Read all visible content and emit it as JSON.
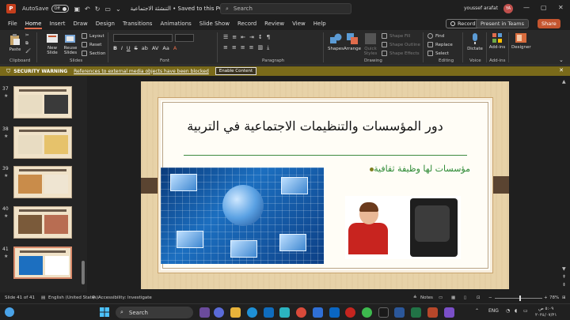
{
  "titlebar": {
    "autosave_label": "AutoSave",
    "autosave_state": "Off",
    "doc_title": "التنشئة الاجتماعية • Saved to this PC ⌄",
    "search_placeholder": "Search",
    "user_name": "youssef arafat",
    "user_initials": "YA"
  },
  "tabs": [
    "File",
    "Home",
    "Insert",
    "Draw",
    "Design",
    "Transitions",
    "Animations",
    "Slide Show",
    "Record",
    "Review",
    "View",
    "Help"
  ],
  "ribbon_actions": {
    "record": "Record",
    "teams": "Present in Teams",
    "share": "Share"
  },
  "ribbon": {
    "paste": "Paste",
    "new_slide": "New Slide",
    "reuse_slides": "Reuse Slides",
    "layout": "Layout",
    "reset": "Reset",
    "section": "Section",
    "shapes": "Shapes",
    "arrange": "Arrange",
    "quick_styles": "Quick Styles",
    "shape_fill": "Shape Fill",
    "shape_outline": "Shape Outline",
    "shape_effects": "Shape Effects",
    "find": "Find",
    "replace": "Replace",
    "select": "Select",
    "dictate": "Dictate",
    "addins": "Add-ins",
    "designer": "Designer",
    "groups": {
      "clipboard": "Clipboard",
      "slides": "Slides",
      "font": "Font",
      "paragraph": "Paragraph",
      "drawing": "Drawing",
      "editing": "Editing",
      "voice": "Voice",
      "addins": "Add-ins"
    },
    "fmt_buttons": [
      "B",
      "I",
      "U",
      "S",
      "ab",
      "AV",
      "Aa",
      "A"
    ]
  },
  "security": {
    "title": "SECURITY WARNING",
    "message": "References to external media objects have been blocked",
    "button": "Enable Content"
  },
  "thumbnails": [
    {
      "number": "37"
    },
    {
      "number": "38"
    },
    {
      "number": "39"
    },
    {
      "number": "40"
    },
    {
      "number": "41"
    }
  ],
  "slide": {
    "title": "دور المؤسسات والتنظيمات الاجتماعية في التربية",
    "bullet": "مؤسسات لها وظيفة ثقافية"
  },
  "status": {
    "slide_of": "Slide 41 of 41",
    "language": "English (United States)",
    "accessibility": "Accessibility: Investigate",
    "notes": "Notes",
    "zoom": "78%"
  },
  "taskbar": {
    "search": "Search",
    "lang": "ENG",
    "time": "٥:٠٩ ص",
    "date": "٢٠٢٤/٠٧/٢١"
  },
  "colors": {
    "accent": "#c4552f",
    "security_bar": "#7a6a1a",
    "slide_title": "#111111",
    "slide_bullet": "#2d8a35"
  }
}
